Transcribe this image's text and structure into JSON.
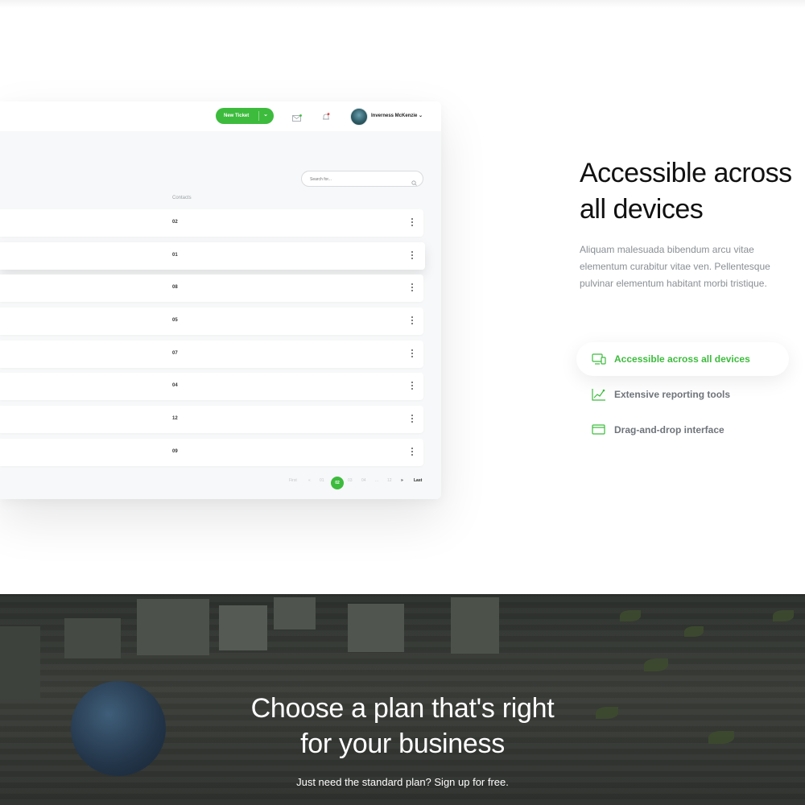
{
  "dashboard": {
    "new_ticket_label": "New Ticket",
    "user_name": "Inverness McKenzie",
    "search_placeholder": "Search for...",
    "column_header": "Contacts",
    "rows": [
      "02",
      "01",
      "08",
      "05",
      "07",
      "04",
      "12",
      "09"
    ],
    "pagination": {
      "first": "First",
      "prev": "«",
      "pages": [
        "01",
        "02",
        "03",
        "04"
      ],
      "active": "02",
      "ellipsis": "...",
      "last_page": "12",
      "next": "»",
      "last": "Last"
    }
  },
  "feature_section": {
    "headline_line1": "Accessible across",
    "headline_line2": "all devices",
    "description": "Aliquam malesuada bibendum arcu vitae elementum curabitur vitae ven. Pellentesque pulvinar elementum habitant morbi tristique.",
    "features": [
      {
        "label": "Accessible across all devices",
        "icon": "devices-icon",
        "active": true
      },
      {
        "label": "Extensive reporting tools",
        "icon": "chart-icon",
        "active": false
      },
      {
        "label": "Drag-and-drop interface",
        "icon": "window-icon",
        "active": false
      }
    ]
  },
  "pricing_hero": {
    "title_line1": "Choose a plan that's right",
    "title_line2": "for your business",
    "subtitle": "Just need the standard plan? Sign up for free."
  },
  "colors": {
    "accent": "#3dbb3d",
    "text_dark": "#111111",
    "text_muted": "#8a8f94"
  }
}
